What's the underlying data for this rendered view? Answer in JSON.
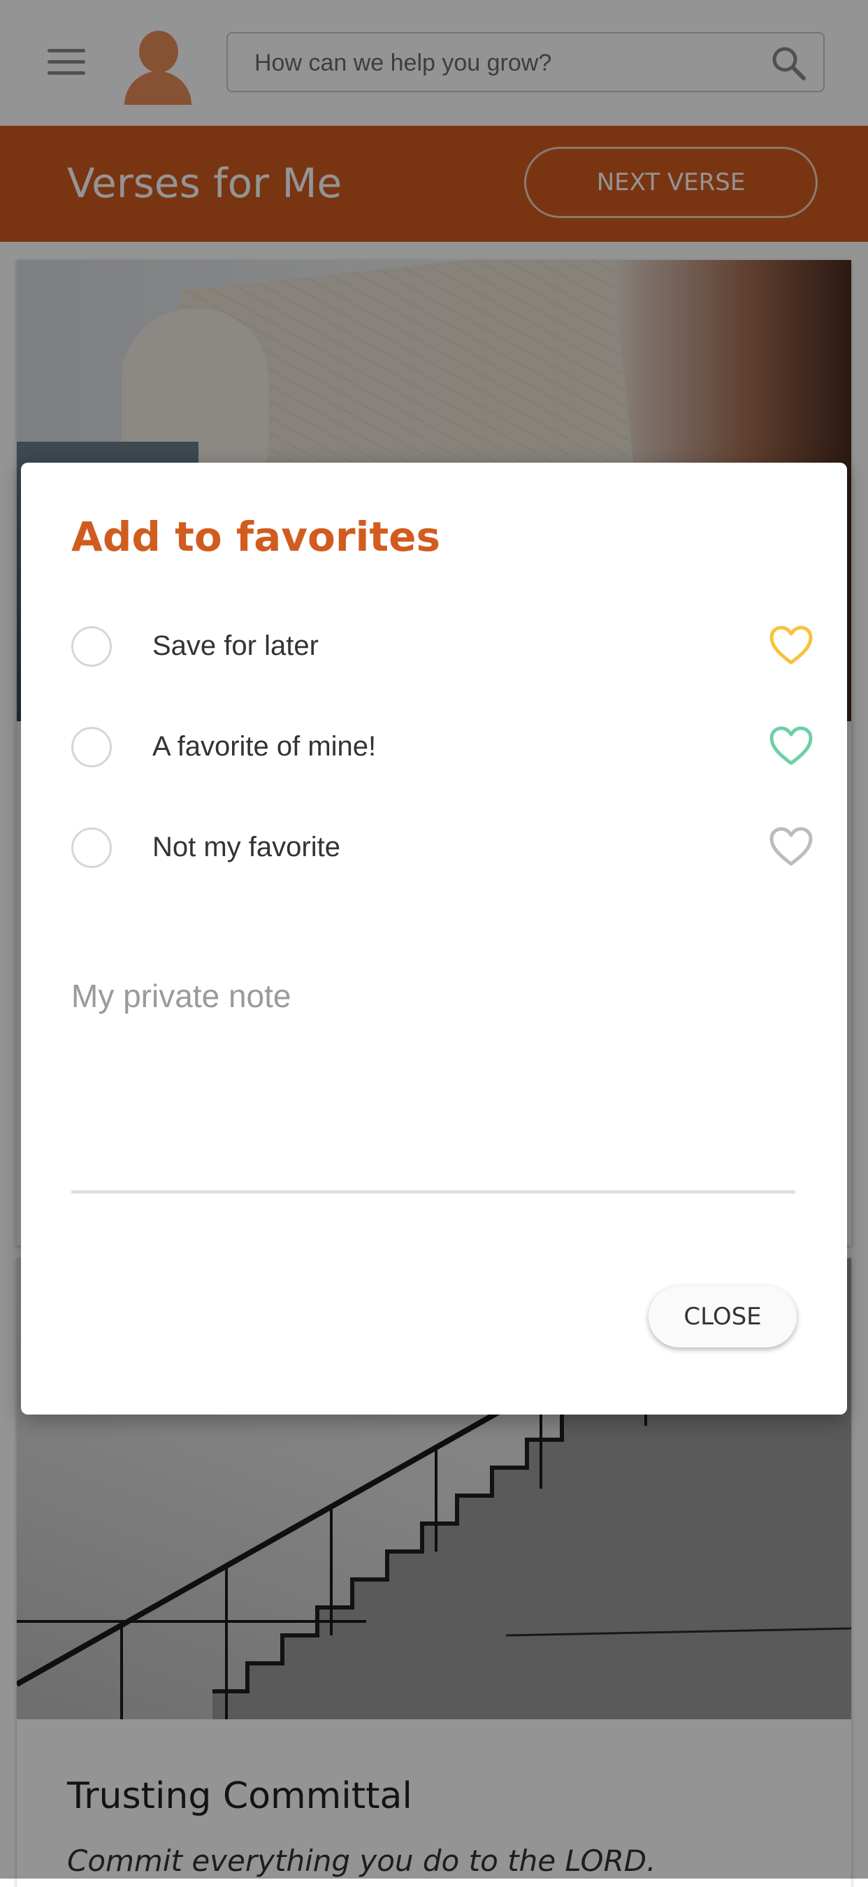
{
  "header": {
    "search_placeholder": "How can we help you grow?",
    "menu_icon": "hamburger-menu-icon",
    "avatar_icon": "user-avatar-icon",
    "search_icon": "search-icon"
  },
  "banner": {
    "title": "Verses for Me",
    "next_button_label": "NEXT VERSE",
    "color": "#d15c1f"
  },
  "cards": [
    {
      "image": "map-photo"
    },
    {
      "image": "staircase-photo",
      "title": "Trusting Committal",
      "verse": "Commit everything you do to the LORD."
    }
  ],
  "dialog": {
    "title": "Add to favorites",
    "options": [
      {
        "label": "Save for later",
        "icon": "heart-outline-icon",
        "icon_color": "#f7c33d"
      },
      {
        "label": "A favorite of mine!",
        "icon": "heart-outline-icon",
        "icon_color": "#6ecfa6"
      },
      {
        "label": "Not my favorite",
        "icon": "heart-outline-icon",
        "icon_color": "#bcbcbc"
      }
    ],
    "note_placeholder": "My private note",
    "close_label": "CLOSE"
  }
}
